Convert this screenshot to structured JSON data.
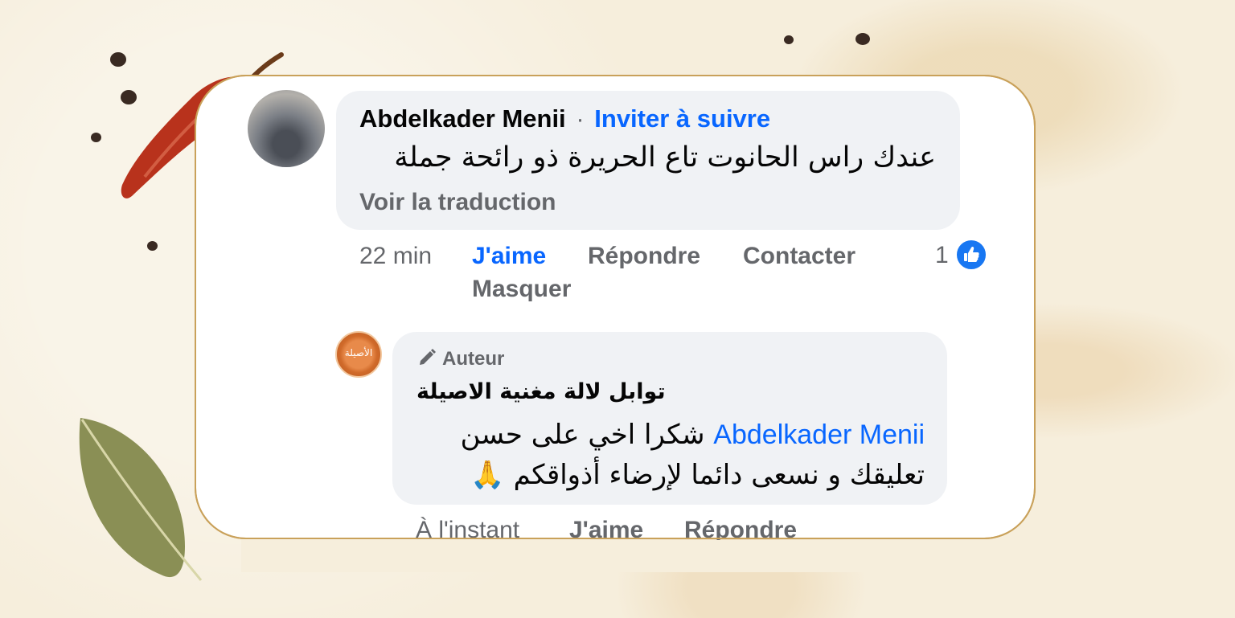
{
  "comment": {
    "author": "Abdelkader Menii",
    "separator": "·",
    "invite_label": "Inviter à suivre",
    "text": "عندك راس الحانوت تاع الحريرة  ذو رائحة جملة",
    "translate_label": "Voir la traduction",
    "time": "22 min",
    "like_label": "J'aime",
    "reply_label": "Répondre",
    "contact_label": "Contacter",
    "hide_label": "Masquer",
    "reaction_count": "1",
    "reaction_icon": "thumbs-up-icon"
  },
  "reply": {
    "badge_label": "Auteur",
    "badge_icon": "pencil-icon",
    "author": "توابل لالة مغنية الاصيلة",
    "mention": "Abdelkader Menii",
    "text": " شكرا اخي على حسن تعليقك و نسعى دائما لإرضاء أذواقكم 🙏",
    "time": "À l'instant",
    "like_label": "J'aime",
    "reply_label": "Répondre",
    "avatar_logo_text": "الأصيلة"
  },
  "colors": {
    "accent_blue": "#0866ff",
    "bubble_bg": "#f0f2f5",
    "muted_text": "#65676b",
    "card_border": "#c9a15a"
  }
}
